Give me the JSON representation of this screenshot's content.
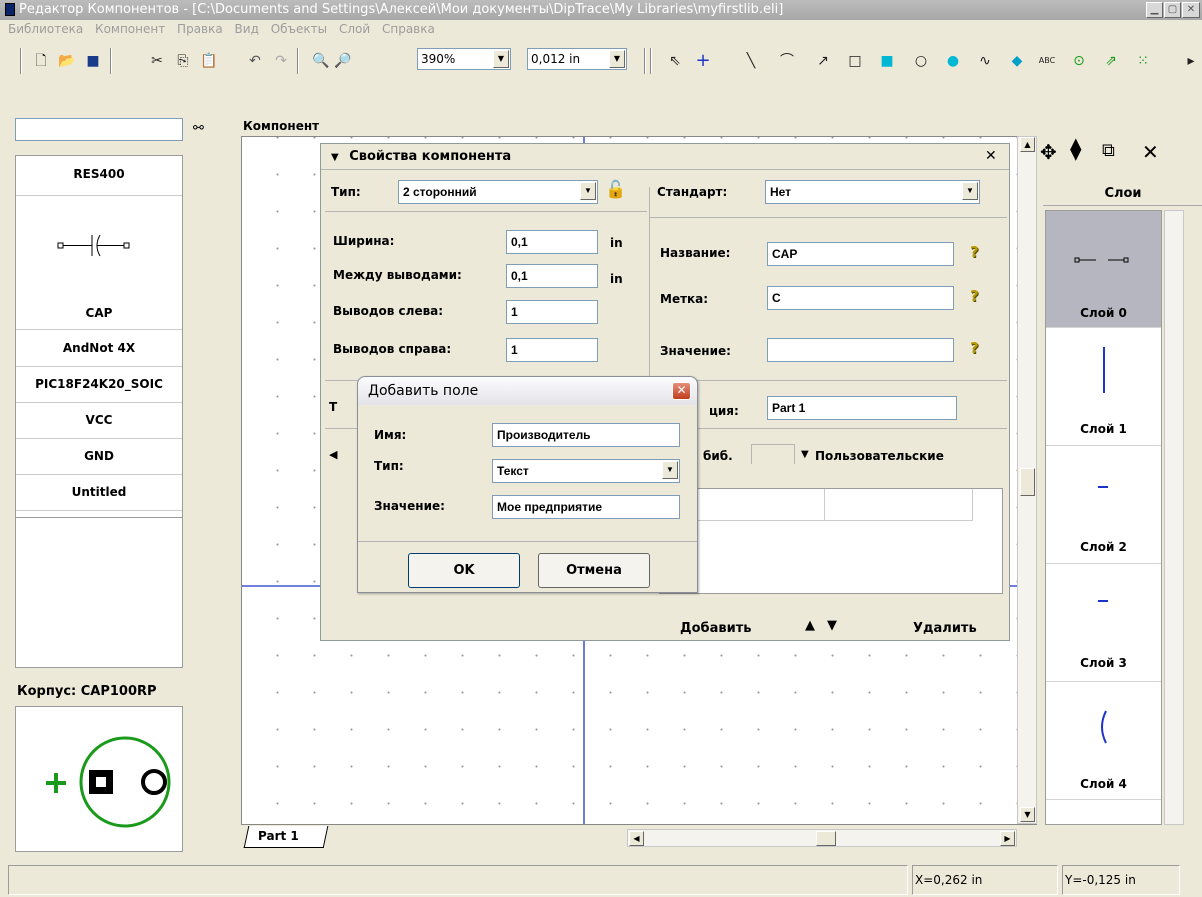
{
  "window": {
    "title": "Редактор Компонентов - [C:\\Documents and Settings\\Алексей\\Мои документы\\DipTrace\\My Libraries\\myfirstlib.eli]"
  },
  "menu": [
    "Библиотека",
    "Компонент",
    "Правка",
    "Вид",
    "Объекты",
    "Слой",
    "Справка"
  ],
  "toolbar": {
    "zoom": "390%",
    "grid": "0,012 in",
    "text_tool_label": "ABC"
  },
  "left_panel": {
    "search_value": "",
    "items": [
      "RES400",
      "CAP",
      "AndNot 4X",
      "PIC18F24K20_SOIC",
      "VCC",
      "GND",
      "Untitled"
    ],
    "package_label": "Корпус: CAP100RP"
  },
  "canvas": {
    "label": "Компонент",
    "tab": "Part 1"
  },
  "properties": {
    "title": "Свойства компонента",
    "type_label": "Тип:",
    "type_value": "2 сторонний",
    "standard_label": "Стандарт:",
    "standard_value": "Нет",
    "width_label": "Ширина:",
    "width_value": "0,1",
    "width_unit": "in",
    "spacing_label": "Между выводами:",
    "spacing_value": "0,1",
    "spacing_unit": "in",
    "pins_left_label": "Выводов слева:",
    "pins_left_value": "1",
    "pins_right_label": "Выводов справа:",
    "pins_right_value": "1",
    "name_label": "Название:",
    "name_value": "CAP",
    "ref_label": "Метка:",
    "ref_value": "C",
    "value_label": "Значение:",
    "value_value": "",
    "part_label_tail": "ция:",
    "part_value": "Part 1",
    "type2_label_head": "Т",
    "lib_tab_tail": "биб.",
    "custom_tab": "Пользовательские",
    "add_button": "Добавить",
    "delete_button": "Удалить"
  },
  "dialog": {
    "title": "Добавить поле",
    "name_label": "Имя:",
    "name_value": "Производитель",
    "type_label": "Тип:",
    "type_value": "Текст",
    "value_label": "Значение:",
    "value_value": "Мое предприятие",
    "ok": "OK",
    "cancel": "Отмена"
  },
  "layers": {
    "header": "Слои",
    "items": [
      "Слой 0",
      "Слой 1",
      "Слой 2",
      "Слой 3",
      "Слой 4"
    ]
  },
  "status": {
    "x": "X=0,262 in",
    "y": "Y=-0,125 in"
  }
}
